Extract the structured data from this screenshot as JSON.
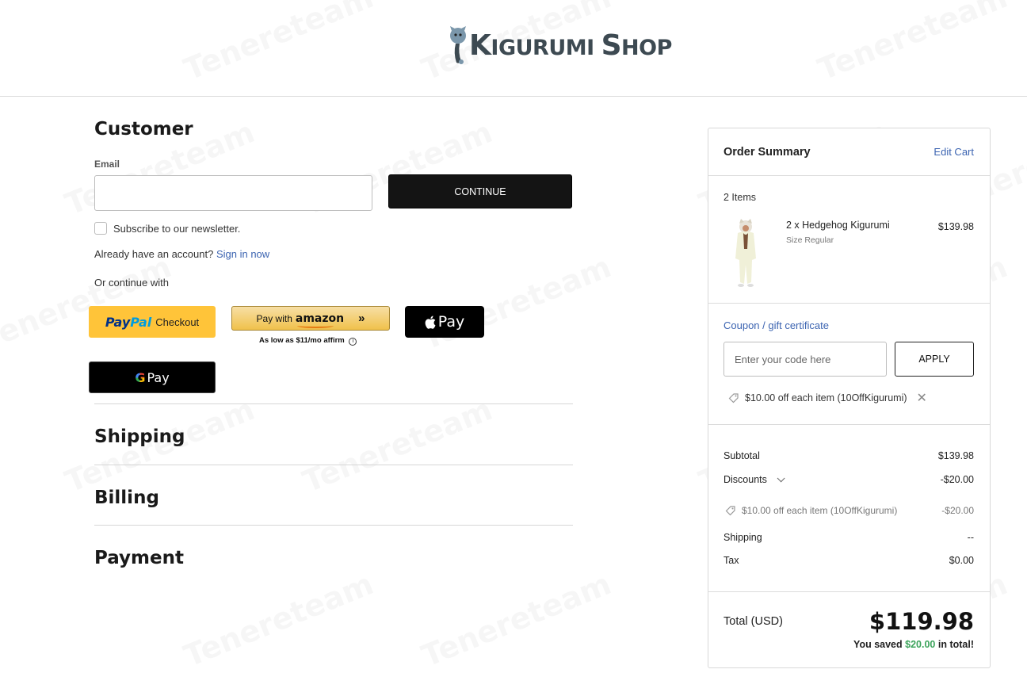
{
  "brand": {
    "name_first": "K",
    "name_rest": "IGURUMI ",
    "name_second": "S",
    "name_second_rest": "HOP"
  },
  "customer": {
    "title": "Customer",
    "email_label": "Email",
    "email_value": "",
    "continue_label": "CONTINUE",
    "newsletter_label": "Subscribe to our newsletter.",
    "account_prompt": "Already have an account?",
    "sign_in_label": "Sign in now",
    "continue_with": "Or continue with"
  },
  "payments": {
    "paypal_pay": "Pay",
    "paypal_pal": "Pal",
    "paypal_text": "Checkout",
    "amazon_text": "Pay with",
    "amazon_brand": "amazon",
    "affirm_text": "As low as $11/mo",
    "affirm_brand": "affirm",
    "applepay_text": "Pay",
    "gpay_g": "G",
    "gpay_text": "Pay"
  },
  "sections": {
    "shipping": "Shipping",
    "billing": "Billing",
    "payment": "Payment"
  },
  "summary": {
    "title": "Order Summary",
    "edit_cart": "Edit Cart",
    "items_count": "2 Items",
    "items": [
      {
        "name": "2 x Hedgehog Kigurumi",
        "size": "Size Regular",
        "price": "$139.98"
      }
    ],
    "coupon_link": "Coupon / gift certificate",
    "coupon_placeholder": "Enter your code here",
    "apply_label": "APPLY",
    "applied_coupon": "$10.00 off each item (10OffKigurumi)",
    "subtotal_label": "Subtotal",
    "subtotal_value": "$139.98",
    "discounts_label": "Discounts",
    "discounts_value": "-$20.00",
    "discount_detail_label": "$10.00 off each item (10OffKigurumi)",
    "discount_detail_value": "-$20.00",
    "shipping_label": "Shipping",
    "shipping_value": "--",
    "tax_label": "Tax",
    "tax_value": "$0.00",
    "total_label": "Total (USD)",
    "total_value": "$119.98",
    "saved_prefix": "You saved",
    "saved_amount": "$20.00",
    "saved_suffix": "in total!"
  },
  "watermark": "Tenereteam",
  "colors": {
    "link": "#3c64b1",
    "paypal_yellow": "#ffc439",
    "savings_green": "#3ca35b"
  }
}
